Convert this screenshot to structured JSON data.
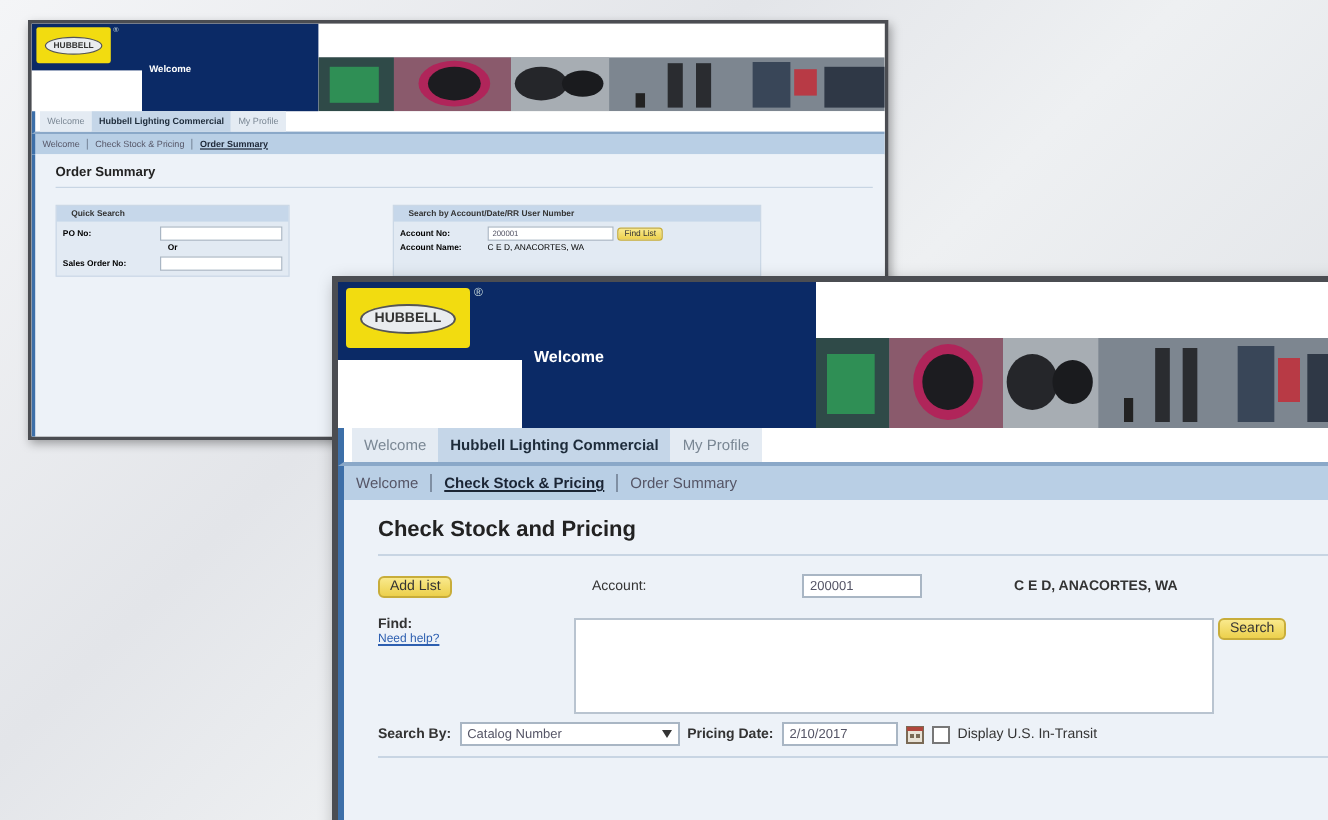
{
  "windows": [
    {
      "kind": "order_summary",
      "header": {
        "logo": "HUBBELL",
        "logo_mark": "®",
        "welcome": "Welcome"
      },
      "tabs": [
        {
          "label": "Welcome",
          "selected": false
        },
        {
          "label": "Hubbell Lighting Commercial",
          "selected": true
        },
        {
          "label": "My Profile",
          "selected": false
        }
      ],
      "subnav": [
        {
          "label": "Welcome",
          "selected": false
        },
        {
          "label": "Check Stock & Pricing",
          "selected": false
        },
        {
          "label": "Order Summary",
          "selected": true
        }
      ],
      "page_title": "Order Summary",
      "quick_search": {
        "title": "Quick Search",
        "po_label": "PO No:",
        "or": "Or",
        "sales_order_label": "Sales Order No:"
      },
      "account_search": {
        "title": "Search by Account/Date/RR User Number",
        "account_label": "Account No:",
        "account_value": "200001",
        "button": "Find List",
        "name_label": "Account Name:",
        "name_value": "C E D, ANACORTES, WA"
      }
    },
    {
      "kind": "check_stock",
      "header": {
        "logo": "HUBBELL",
        "logo_mark": "®",
        "welcome": "Welcome"
      },
      "tabs": [
        {
          "label": "Welcome",
          "selected": false
        },
        {
          "label": "Hubbell Lighting Commercial",
          "selected": true
        },
        {
          "label": "My Profile",
          "selected": false
        }
      ],
      "subnav": [
        {
          "label": "Welcome",
          "selected": false
        },
        {
          "label": "Check Stock & Pricing",
          "selected": true
        },
        {
          "label": "Order Summary",
          "selected": false
        }
      ],
      "page_title": "Check Stock and Pricing",
      "add_list_button": "Add List",
      "account_label": "Account:",
      "account_value": "200001",
      "account_name": "C E D, ANACORTES, WA",
      "find_label": "Find:",
      "help_link": "Need help?",
      "search_button": "Search",
      "search_by_label": "Search By:",
      "search_by_value": "Catalog Number",
      "pricing_date_label": "Pricing Date:",
      "pricing_date_value": "2/10/2017",
      "in_transit": {
        "label": "Display U.S. In-Transit",
        "checked": false
      }
    }
  ]
}
